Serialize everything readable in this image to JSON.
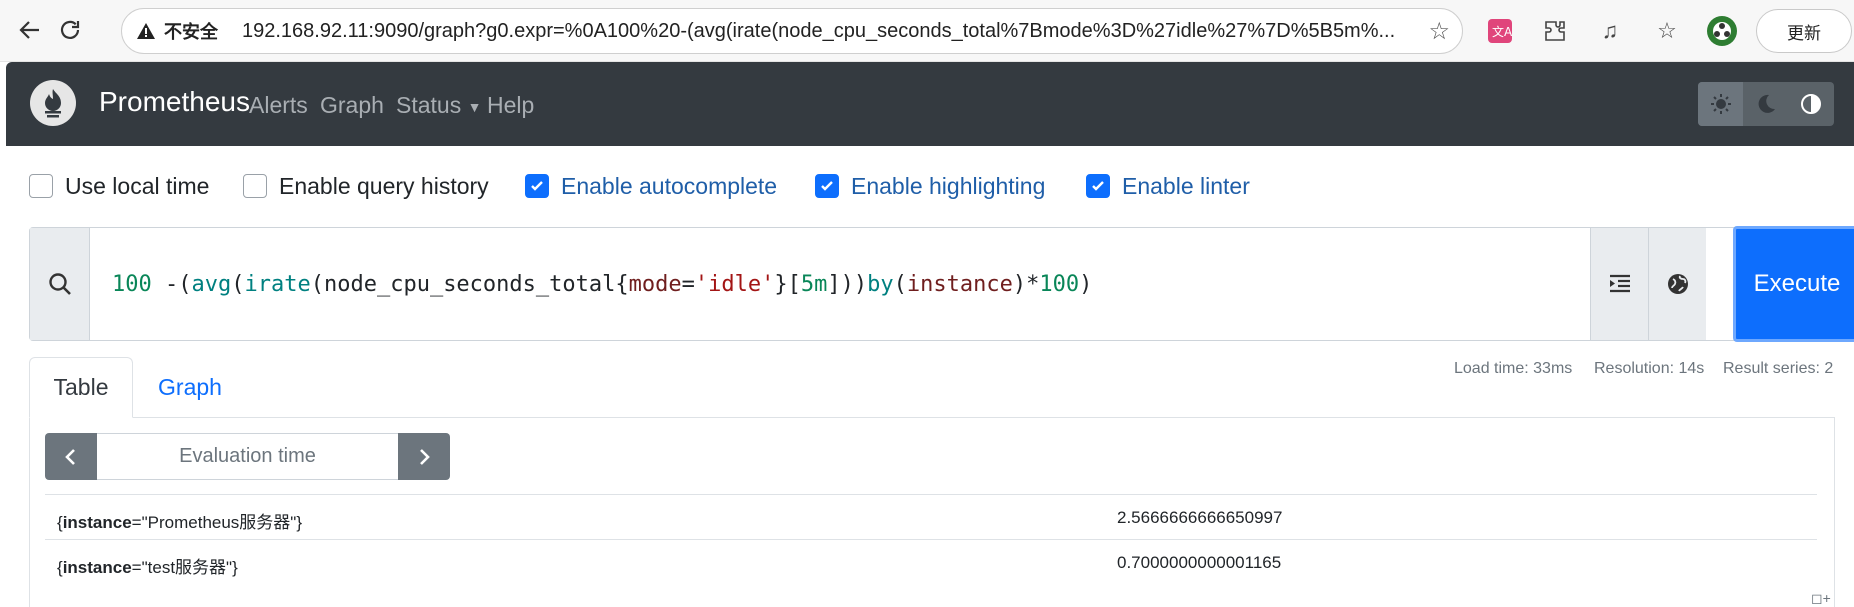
{
  "browser": {
    "insecure_label": "不安全",
    "url": "192.168.92.11:9090/graph?g0.expr=%0A100%20-(avg(irate(node_cpu_seconds_total%7Bmode%3D%27idle%27%7D%5B5m%...",
    "update_label": "更新"
  },
  "navbar": {
    "brand": "Prometheus",
    "items": [
      {
        "label": "Alerts"
      },
      {
        "label": "Graph"
      },
      {
        "label": "Status"
      },
      {
        "label": "Help"
      }
    ]
  },
  "options": [
    {
      "label": "Use local time",
      "checked": false
    },
    {
      "label": "Enable query history",
      "checked": false
    },
    {
      "label": "Enable autocomplete",
      "checked": true
    },
    {
      "label": "Enable highlighting",
      "checked": true
    },
    {
      "label": "Enable linter",
      "checked": true
    }
  ],
  "expression": {
    "tokens": {
      "t1": "100",
      "t2": " -(",
      "t3": "avg",
      "t4": "(",
      "t5": "irate",
      "t6": "(",
      "t7": "node_cpu_seconds_total",
      "t8": "{",
      "t9": "mode",
      "t10": "=",
      "t11": "'idle'",
      "t12": "}[",
      "t13": "5m",
      "t14": "]))",
      "t15": "by",
      "t16": "(",
      "t17": "instance",
      "t18": ")*",
      "t19": "100",
      "t20": ")"
    },
    "execute_label": "Execute"
  },
  "tabs": {
    "table": "Table",
    "graph": "Graph"
  },
  "stats": {
    "load_time": "Load time: 33ms",
    "resolution": "Resolution: 14s",
    "result_series": "Result series: 2"
  },
  "eval_time": {
    "placeholder": "Evaluation time"
  },
  "results": [
    {
      "label_key": "instance",
      "label_value": "\"Prometheus服务器\"",
      "value": "2.5666666666650997"
    },
    {
      "label_key": "instance",
      "label_value": "\"test服务器\"",
      "value": "0.7000000000001165"
    }
  ],
  "colors": {
    "navbar_bg": "#343a40",
    "primary": "#0d6efd",
    "secondary": "#6c757d"
  }
}
